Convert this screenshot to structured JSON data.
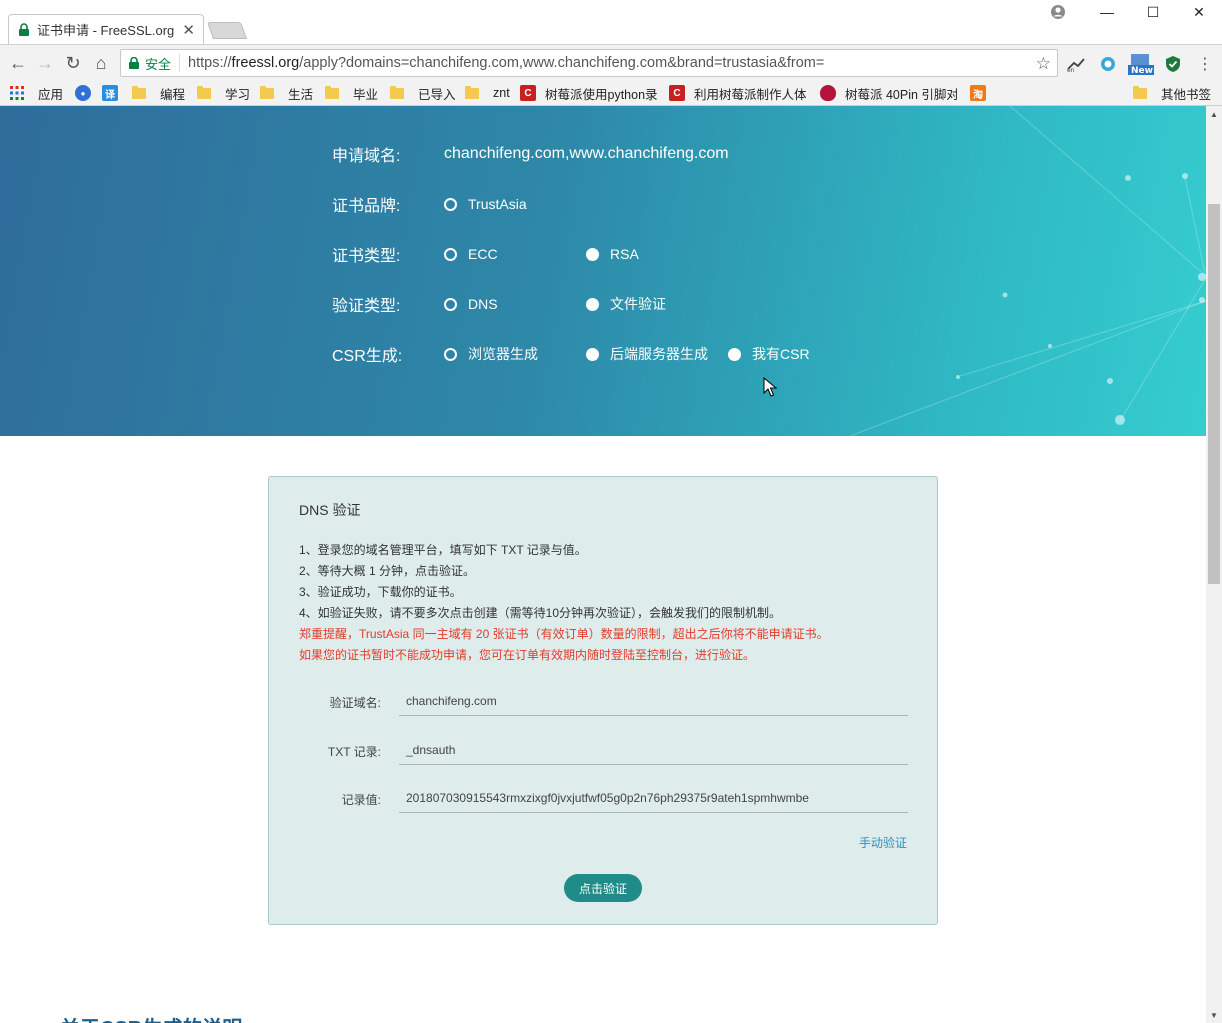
{
  "browser": {
    "tab_title": "证书申请 - FreeSSL.org -",
    "secure_label": "安全",
    "url_scheme": "https://",
    "url_host": "freessl.org",
    "url_path": "/apply?domains=chanchifeng.com,www.chanchifeng.com&brand=trustasia&from=",
    "window_controls": [
      "minimize-icon",
      "maximize-icon",
      "close-icon"
    ],
    "extensions": [
      {
        "icon": "network-ext-icon",
        "label": "en"
      },
      {
        "icon": "circle-ext-icon",
        "label": ""
      },
      {
        "icon": "new-ext-icon",
        "label": "New"
      },
      {
        "icon": "shield-ext-icon",
        "label": ""
      }
    ]
  },
  "bookmarks": {
    "apps_label": "应用",
    "items": [
      {
        "label": "",
        "icon": "paw-icon",
        "color": "#2f6fd6"
      },
      {
        "label": "",
        "icon": "translate-icon",
        "color": "#2a8ee0",
        "glyph": "译"
      },
      {
        "label": "编程",
        "icon": "folder-icon"
      },
      {
        "label": "学习",
        "icon": "folder-icon"
      },
      {
        "label": "生活",
        "icon": "folder-icon"
      },
      {
        "label": "毕业",
        "icon": "folder-icon"
      },
      {
        "label": "已导入",
        "icon": "folder-icon"
      },
      {
        "label": "znt",
        "icon": "folder-icon"
      },
      {
        "label": "树莓派使用python录",
        "icon": "csdn-icon",
        "color": "#c8201e",
        "glyph": "C"
      },
      {
        "label": "利用树莓派制作人体",
        "icon": "csdn-icon",
        "color": "#c8201e",
        "glyph": "C"
      },
      {
        "label": "树莓派 40Pin 引脚对",
        "icon": "raspberry-icon",
        "color": "#b5123c"
      },
      {
        "label": "",
        "icon": "taobao-icon",
        "color": "#f07a1a",
        "glyph": "淘"
      }
    ],
    "other_label": "其他书签"
  },
  "form": {
    "domain_label": "申请域名:",
    "domain_value": "chanchifeng.com,www.chanchifeng.com",
    "brand_label": "证书品牌:",
    "brand_options": [
      {
        "label": "TrustAsia",
        "selected": true
      }
    ],
    "type_label": "证书类型:",
    "type_options": [
      {
        "label": "ECC",
        "selected": true
      },
      {
        "label": "RSA",
        "selected": false
      }
    ],
    "verify_label": "验证类型:",
    "verify_options": [
      {
        "label": "DNS",
        "selected": true
      },
      {
        "label": "文件验证",
        "selected": false
      }
    ],
    "csr_label": "CSR生成:",
    "csr_options": [
      {
        "label": "浏览器生成",
        "selected": true
      },
      {
        "label": "后端服务器生成",
        "selected": false
      },
      {
        "label": "我有CSR",
        "selected": false
      }
    ]
  },
  "dns_card": {
    "title": "DNS 验证",
    "steps": [
      "1、登录您的域名管理平台，填写如下 TXT 记录与值。",
      "2、等待大概 1 分钟，点击验证。",
      "3、验证成功，下载你的证书。",
      "4、如验证失败，请不要多次点击创建（需等待10分钟再次验证），会触发我们的限制机制。"
    ],
    "warnings": [
      "郑重提醒，TrustAsia 同一主域有 20 张证书（有效订单）数量的限制，超出之后你将不能申请证书。",
      "如果您的证书暂时不能成功申请，您可在订单有效期内随时登陆至控制台，进行验证。"
    ],
    "fields": [
      {
        "label": "验证域名:",
        "value": "chanchifeng.com"
      },
      {
        "label": "TXT 记录:",
        "value": "_dnsauth"
      },
      {
        "label": "记录值:",
        "value": "201807030915543rmxzixgf0jvxjutfwf05g0p2n76ph29375r9ateh1spmhwmbe"
      }
    ],
    "manual_link": "手动验证",
    "verify_button": "点击验证"
  },
  "below_fold_heading": "关于CSR生成的说明",
  "colors": {
    "hero_start": "#2f6d9b",
    "hero_end": "#35cdd0",
    "button": "#1f8c8a",
    "warning": "#e43b2b",
    "link": "#2d8fbe"
  }
}
